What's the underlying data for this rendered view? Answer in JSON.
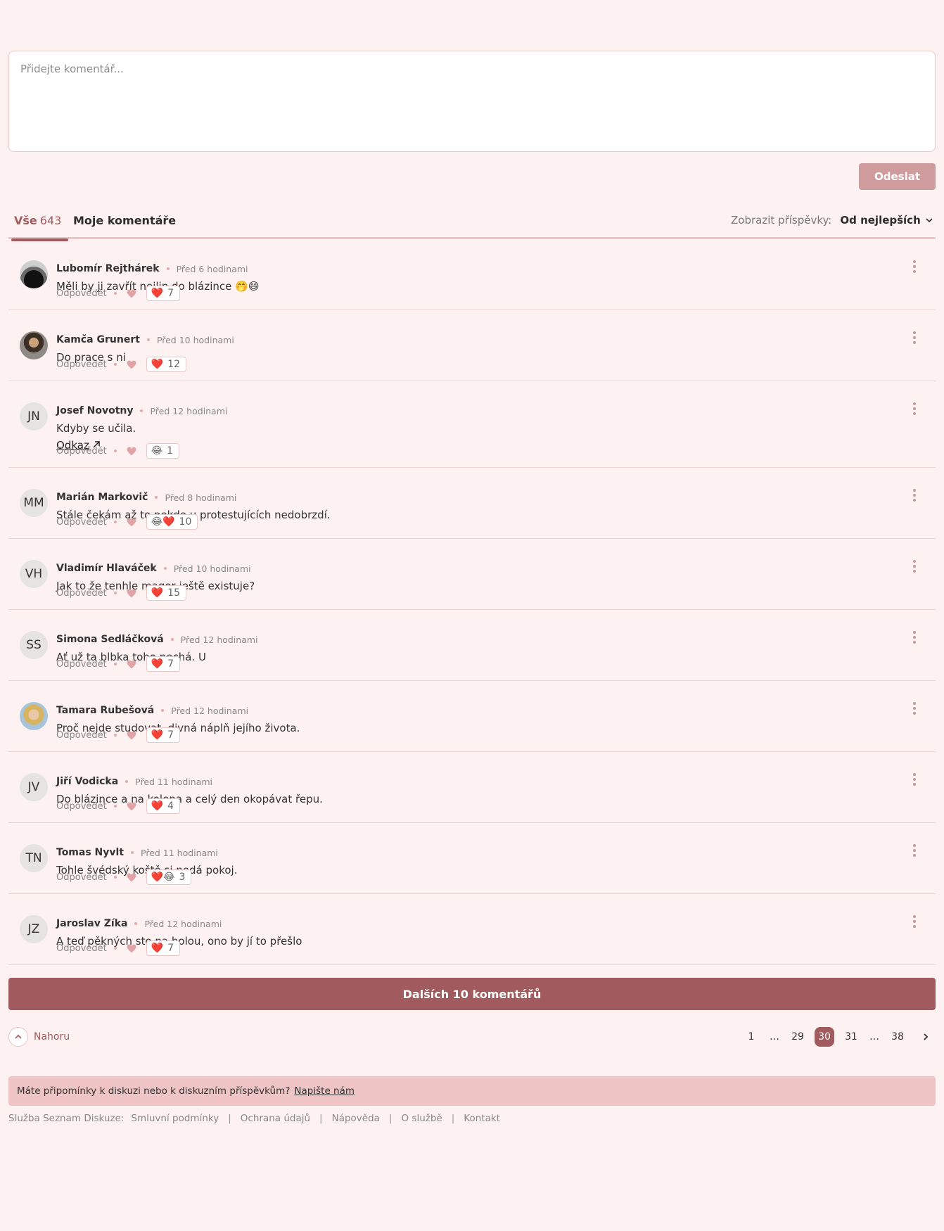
{
  "composer": {
    "placeholder": "Přidejte komentář...",
    "send_label": "Odeslat"
  },
  "tabs": {
    "all_label": "Vše",
    "all_count": "643",
    "mine_label": "Moje komentáře",
    "sort_label": "Zobrazit příspěvky:",
    "sort_value": "Od nejlepších"
  },
  "reply_label": "Odpovědět",
  "comments": [
    {
      "author": "Lubomír Rejthárek",
      "time": "Před 6 hodinami",
      "text": "Měli by ji zavřít nejlip do blázince 🤭😄",
      "reaction": "❤️",
      "count": "7",
      "avatar": ""
    },
    {
      "author": "Kamča Grunert",
      "time": "Před 10 hodinami",
      "text": "Do prace s ni",
      "reaction": "❤️",
      "count": "12",
      "avatar": ""
    },
    {
      "author": "Josef Novotny",
      "time": "Před 12 hodinami",
      "text": "Kdyby se učila.",
      "link": "Odkaz",
      "reaction": "😂",
      "count": "1",
      "avatar": "JN"
    },
    {
      "author": "Marián Markovič",
      "time": "Před 8 hodinami",
      "text": "Stále čekám až to nekdo u protestujících nedobrzdí.",
      "reaction": "😂❤️",
      "count": "10",
      "avatar": "MM"
    },
    {
      "author": "Vladimír Hlaváček",
      "time": "Před 10 hodinami",
      "text": "Jak to že tenhle magor ještě existuje?",
      "reaction": "❤️",
      "count": "15",
      "avatar": "VH"
    },
    {
      "author": "Simona Sedláčková",
      "time": "Před 12 hodinami",
      "text": "Ať už ta blbka toho nechá. U",
      "reaction": "❤️",
      "count": "7",
      "avatar": "SS"
    },
    {
      "author": "Tamara Rubešová",
      "time": "Před 12 hodinami",
      "text": "Proč nejde studovat, divná náplň jejího života.",
      "reaction": "❤️",
      "count": "7",
      "avatar": ""
    },
    {
      "author": "Jiří Vodicka",
      "time": "Před 11 hodinami",
      "text": "Do blázince a na kolena a celý den okopávat řepu.",
      "reaction": "❤️",
      "count": "4",
      "avatar": "JV"
    },
    {
      "author": "Tomas Nyvlt",
      "time": "Před 11 hodinami",
      "text": "Tohle švédský koště si nedá pokoj.",
      "reaction": "❤️😂",
      "count": "3",
      "avatar": "TN"
    },
    {
      "author": "Jaroslav Zíka",
      "time": "Před 12 hodinami",
      "text": "A teď pěkných sto na holou, ono by jí to přešlo",
      "reaction": "❤️",
      "count": "7",
      "avatar": "JZ"
    }
  ],
  "more_button": "Dalších 10 komentářů",
  "back_to_top": "Nahoru",
  "pagination": {
    "pages": [
      "1",
      "…",
      "29",
      "30",
      "31",
      "…",
      "38"
    ],
    "current": "30"
  },
  "feedback": {
    "text": "Máte připomínky k diskuzi nebo k diskuzním příspěvkům?",
    "link": "Napište nám"
  },
  "footer": {
    "label": "Služba Seznam Diskuze:",
    "links": [
      "Smluvní podmínky",
      "Ochrana údajů",
      "Nápověda",
      "O službě",
      "Kontakt"
    ]
  },
  "colors": {
    "accent": "#a15a5d",
    "background": "#fdf2f1",
    "disabled_button": "#cf9b9d",
    "feedback_bg": "#efc4c4"
  }
}
